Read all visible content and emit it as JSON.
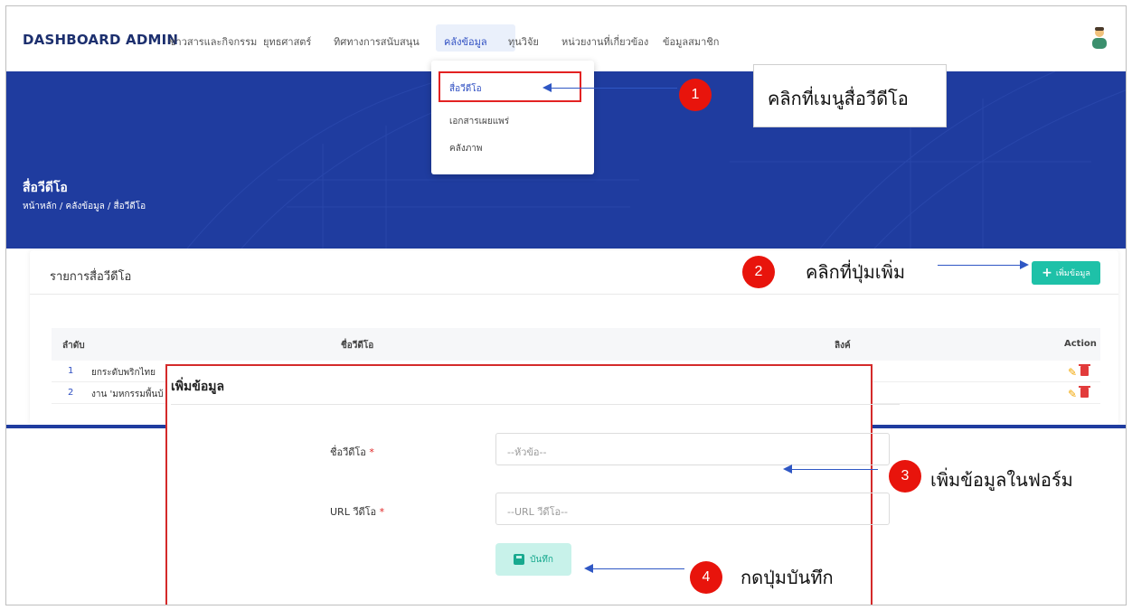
{
  "nav": {
    "brand": "DASHBOARD ADMIN",
    "items": [
      "ข่าวสารและกิจกรรม",
      "ยุทธศาสตร์",
      "ทิศทางการสนับสนุน",
      "คลังข้อมูล",
      "ทุนวิจัย",
      "หน่วยงานที่เกี่ยวข้อง",
      "ข้อมูลสมาชิก"
    ],
    "active_index": 3
  },
  "dropdown": {
    "items": [
      "สื่อวีดีโอ",
      "เอกสารเผยแพร่",
      "คลังภาพ"
    ]
  },
  "hero": {
    "title": "สื่อวีดีโอ",
    "breadcrumb": "หน้าหลัก / คลังข้อมูล / สื่อวีดีโอ"
  },
  "card": {
    "title": "รายการสื่อวีดีโอ",
    "add_button": "เพิ่มข้อมูล"
  },
  "table": {
    "headers": [
      "ลำดับ",
      "ชื่อวีดีโอ",
      "ลิงค์",
      "Action"
    ],
    "rows": [
      {
        "no": "1",
        "name": "ยกระดับพริกไทย"
      },
      {
        "no": "2",
        "name": "งาน 'มหกรรมพื้นบ้"
      }
    ]
  },
  "modal": {
    "title": "เพิ่มข้อมูล",
    "field1_label": "ชื่อวีดีโอ",
    "field1_placeholder": "--หัวข้อ--",
    "field2_label": "URL วีดีโอ",
    "field2_placeholder": "--URL วีดีโอ--",
    "required_mark": "*",
    "save_label": "บันทึก"
  },
  "annotations": [
    {
      "number": "1",
      "text": "คลิกที่เมนูสื่อวีดีโอ"
    },
    {
      "number": "2",
      "text": "คลิกที่ปุ่มเพิ่ม"
    },
    {
      "number": "3",
      "text": "เพิ่มข้อมูลในฟอร์ม"
    },
    {
      "number": "4",
      "text": "กดปุ่มบันทึก"
    }
  ],
  "colors": {
    "hero_blue": "#1f3c9f",
    "accent_teal": "#1ec1a8",
    "annotation_red": "#e8140c",
    "arrow_blue": "#2f57c4"
  }
}
